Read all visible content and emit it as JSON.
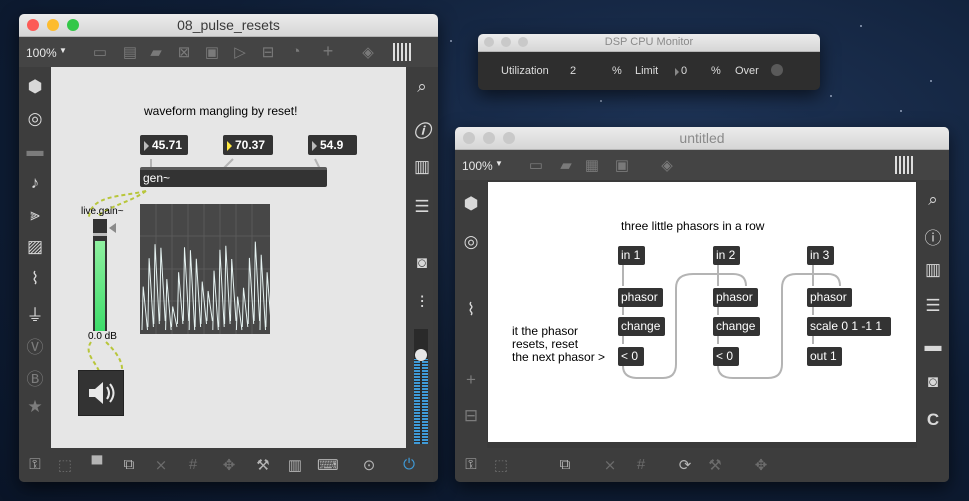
{
  "window_main": {
    "title": "08_pulse_resets",
    "zoom": "100%",
    "comment": "waveform mangling by reset!",
    "numbers": [
      "45.71",
      "70.37",
      "54.9"
    ],
    "gen_label": "gen~",
    "gain_label": "live.gain~",
    "gain_value": "0.0 dB",
    "gain_level": 0.78
  },
  "window_cpu": {
    "title": "DSP CPU Monitor",
    "utilization_label": "Utilization",
    "utilization_value": "2",
    "percent_1": "%",
    "limit_label": "Limit",
    "limit_value": "0",
    "percent_2": "%",
    "over_label": "Over"
  },
  "window_untitled": {
    "title": "untitled",
    "zoom": "100%",
    "comment_top": "three little phasors in a row",
    "comment_left": "it the phasor\nresets, reset\nthe next phasor >",
    "col1": [
      "in 1",
      "phasor",
      "change",
      "< 0"
    ],
    "col2": [
      "in 2",
      "phasor",
      "change",
      "< 0"
    ],
    "col3": [
      "in 3",
      "phasor",
      "scale 0 1 -1 1",
      "out 1"
    ]
  },
  "icons": {
    "lock": "lock-icon",
    "search": "search-icon",
    "info": "info-icon",
    "camera": "camera-icon",
    "speaker": "speaker-icon"
  },
  "colors": {
    "accent": "#3f9ad7",
    "number_active": "#ffe940",
    "meter_green": "#3ddc6a",
    "patch_cord": "#b4b4b4",
    "signal_cord": "#b8c63a"
  }
}
